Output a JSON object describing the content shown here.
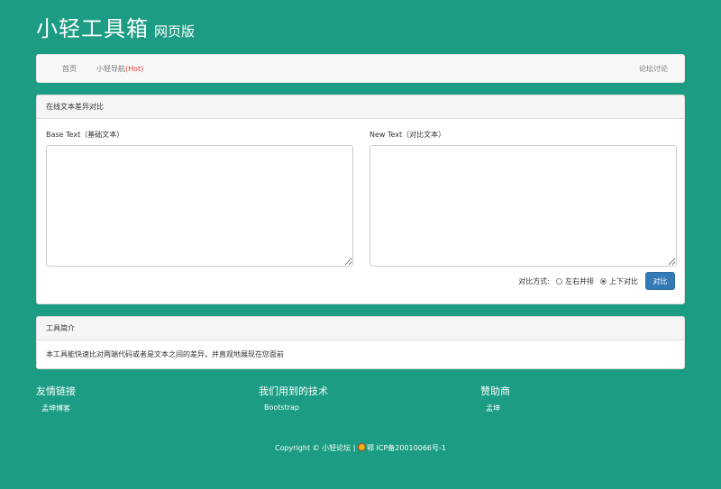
{
  "header": {
    "title": "小轻工具箱",
    "subtitle": "网页版"
  },
  "nav": {
    "home": "首页",
    "guide": "小轻导航",
    "guide_hot": "(Hot)",
    "forum": "论坛讨论"
  },
  "main": {
    "heading": "在线文本差异对比",
    "base_label": "Base Text（基础文本）",
    "new_label": "New Text（对比文本）",
    "base_value": "",
    "new_value": "",
    "compare_mode_label": "对比方式:",
    "option_side": "左右并排",
    "option_inline": "上下对比",
    "selected_option": "上下对比",
    "compare_button": "对比"
  },
  "intro": {
    "heading": "工具简介",
    "body": "本工具能快速比对两端代码或者是文本之间的差异，并直观地展现在您面前"
  },
  "footer": {
    "friends_title": "友情链接",
    "friends_link": "孟坤博客",
    "tech_title": "我们用到的技术",
    "tech_link": "Bootstrap",
    "sponsor_title": "赞助商",
    "sponsor_link": "孟坤",
    "copyright_prefix": "Copyright © 小轻论坛 |",
    "icp": "鄂 ICP备20010066号-1"
  },
  "colors": {
    "background": "#1b9c83",
    "button": "#337ab7",
    "hot": "#ee3333"
  }
}
